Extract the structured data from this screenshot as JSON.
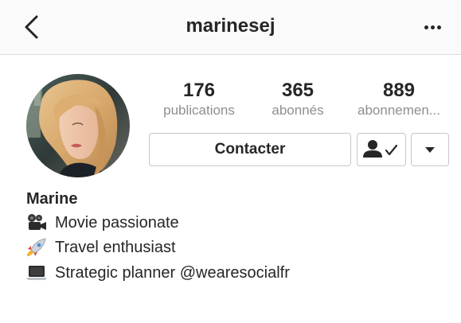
{
  "header": {
    "username": "marinesej",
    "back_icon": "chevron-left-icon",
    "more_icon": "more-horizontal-icon"
  },
  "profile": {
    "avatar_icon": "profile-photo",
    "stats": [
      {
        "value": "176",
        "label": "publications"
      },
      {
        "value": "365",
        "label": "abonnés"
      },
      {
        "value": "889",
        "label": "abonnemen..."
      }
    ],
    "contact_label": "Contacter",
    "following_icon": "person-check-icon",
    "dropdown_icon": "caret-down-icon"
  },
  "bio": {
    "name": "Marine",
    "lines": [
      {
        "icon": "movie-camera-icon",
        "text": "Movie passionate"
      },
      {
        "icon": "rocket-icon",
        "text": "Travel enthusiast"
      },
      {
        "icon": "laptop-icon",
        "text": "Strategic planner @wearesocialfr"
      }
    ]
  }
}
